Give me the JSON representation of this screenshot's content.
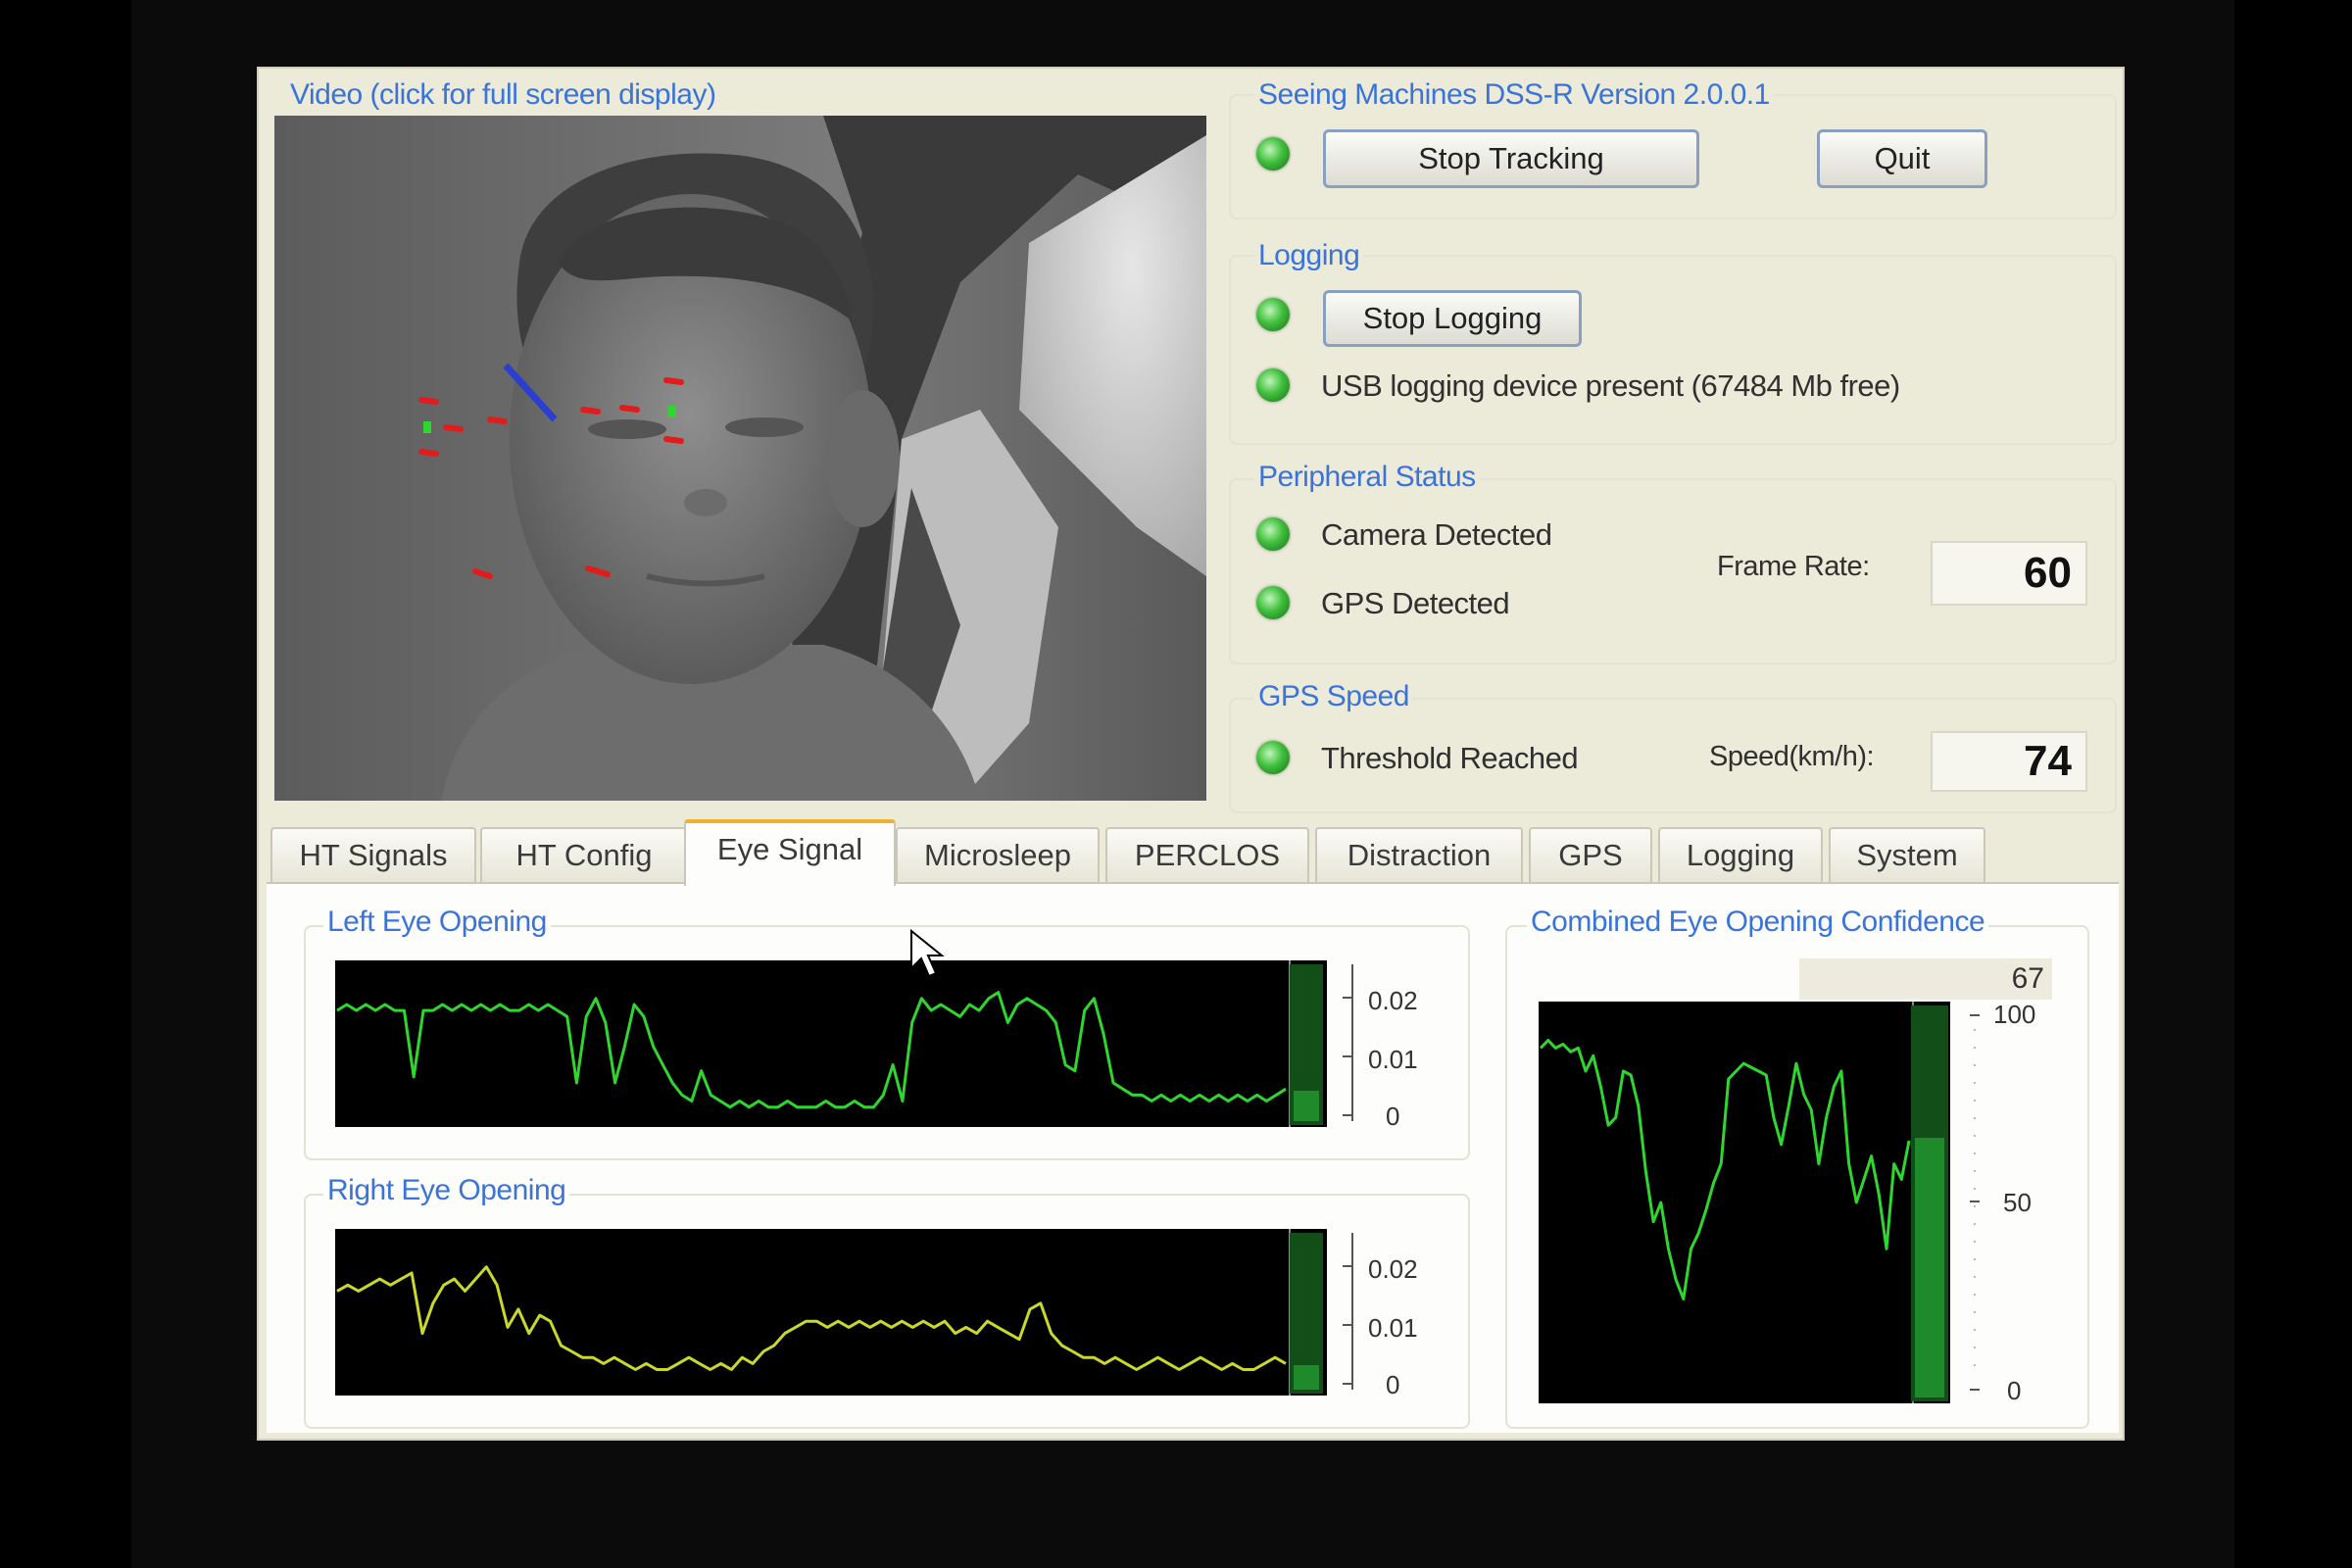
{
  "video": {
    "title": "Video (click for full screen display)"
  },
  "app": {
    "title": "Seeing Machines DSS-R Version 2.0.0.1",
    "stop_tracking_label": "Stop Tracking",
    "quit_label": "Quit"
  },
  "logging": {
    "title": "Logging",
    "stop_logging_label": "Stop Logging",
    "usb_status": "USB logging device present (67484 Mb free)"
  },
  "peripheral": {
    "title": "Peripheral Status",
    "camera": "Camera Detected",
    "gps": "GPS Detected",
    "frame_rate_label": "Frame Rate:",
    "frame_rate_value": "60"
  },
  "gps_speed": {
    "title": "GPS Speed",
    "threshold": "Threshold Reached",
    "speed_label": "Speed(km/h):",
    "speed_value": "74"
  },
  "tabs": [
    "HT Signals",
    "HT Config",
    "Eye Signal",
    "Microsleep",
    "PERCLOS",
    "Distraction",
    "GPS",
    "Logging",
    "System"
  ],
  "active_tab": "Eye Signal",
  "eye_signal": {
    "left_title": "Left Eye Opening",
    "right_title": "Right Eye Opening",
    "combined_title": "Combined Eye Opening Confidence",
    "combined_value": "67",
    "eye_ticks": [
      "0.02",
      "0.01",
      "0"
    ],
    "combined_ticks": [
      "100",
      "50",
      "0"
    ]
  },
  "colors": {
    "trace": "#2fd62f",
    "trace_yellow": "#c9d82a",
    "group_title": "#3a74d8",
    "led": "#3fbf3c",
    "level_bar": "#1f8a2a"
  },
  "chart_data": [
    {
      "type": "line",
      "title": "Left Eye Opening",
      "ylim": [
        0,
        0.025
      ],
      "ticks": [
        "0.02",
        "0.01",
        "0"
      ],
      "values": [
        0.018,
        0.019,
        0.018,
        0.019,
        0.018,
        0.019,
        0.018,
        0.018,
        0.007,
        0.018,
        0.018,
        0.019,
        0.018,
        0.019,
        0.018,
        0.019,
        0.018,
        0.019,
        0.018,
        0.018,
        0.019,
        0.018,
        0.019,
        0.018,
        0.017,
        0.006,
        0.017,
        0.02,
        0.016,
        0.006,
        0.012,
        0.019,
        0.017,
        0.012,
        0.009,
        0.006,
        0.004,
        0.003,
        0.008,
        0.004,
        0.003,
        0.002,
        0.003,
        0.002,
        0.003,
        0.002,
        0.002,
        0.003,
        0.002,
        0.002,
        0.002,
        0.003,
        0.002,
        0.002,
        0.003,
        0.002,
        0.002,
        0.004,
        0.009,
        0.003,
        0.016,
        0.02,
        0.018,
        0.019,
        0.018,
        0.017,
        0.019,
        0.018,
        0.02,
        0.021,
        0.016,
        0.019,
        0.02,
        0.019,
        0.018,
        0.016,
        0.009,
        0.008,
        0.018,
        0.02,
        0.014,
        0.006,
        0.005,
        0.004,
        0.004,
        0.003,
        0.004,
        0.003,
        0.004,
        0.003,
        0.004,
        0.003,
        0.004,
        0.003,
        0.004,
        0.003,
        0.004,
        0.003,
        0.004,
        0.005
      ]
    },
    {
      "type": "line",
      "title": "Right Eye Opening",
      "ylim": [
        0,
        0.025
      ],
      "ticks": [
        "0.02",
        "0.01",
        "0"
      ],
      "values": [
        0.016,
        0.017,
        0.016,
        0.017,
        0.018,
        0.017,
        0.018,
        0.019,
        0.009,
        0.014,
        0.017,
        0.018,
        0.016,
        0.018,
        0.02,
        0.017,
        0.01,
        0.013,
        0.009,
        0.012,
        0.011,
        0.007,
        0.006,
        0.005,
        0.005,
        0.004,
        0.005,
        0.004,
        0.003,
        0.004,
        0.003,
        0.003,
        0.004,
        0.005,
        0.004,
        0.003,
        0.004,
        0.003,
        0.005,
        0.004,
        0.006,
        0.007,
        0.009,
        0.01,
        0.011,
        0.011,
        0.01,
        0.011,
        0.01,
        0.011,
        0.01,
        0.011,
        0.01,
        0.011,
        0.01,
        0.011,
        0.01,
        0.011,
        0.009,
        0.01,
        0.009,
        0.011,
        0.01,
        0.009,
        0.008,
        0.013,
        0.014,
        0.009,
        0.007,
        0.006,
        0.005,
        0.005,
        0.004,
        0.005,
        0.004,
        0.003,
        0.004,
        0.005,
        0.004,
        0.003,
        0.004,
        0.005,
        0.004,
        0.003,
        0.004,
        0.003,
        0.003,
        0.004,
        0.005,
        0.004
      ]
    },
    {
      "type": "line",
      "title": "Combined Eye Opening Confidence",
      "ylim": [
        0,
        100
      ],
      "ticks": [
        "100",
        "50",
        "0"
      ],
      "current_value": 67,
      "values": [
        90,
        92,
        90,
        91,
        89,
        90,
        84,
        88,
        80,
        70,
        72,
        84,
        83,
        75,
        58,
        45,
        50,
        38,
        30,
        25,
        38,
        42,
        48,
        55,
        60,
        82,
        84,
        86,
        85,
        84,
        83,
        72,
        65,
        75,
        86,
        78,
        74,
        60,
        72,
        80,
        84,
        60,
        50,
        56,
        62,
        52,
        38,
        60,
        56,
        66
      ]
    }
  ]
}
